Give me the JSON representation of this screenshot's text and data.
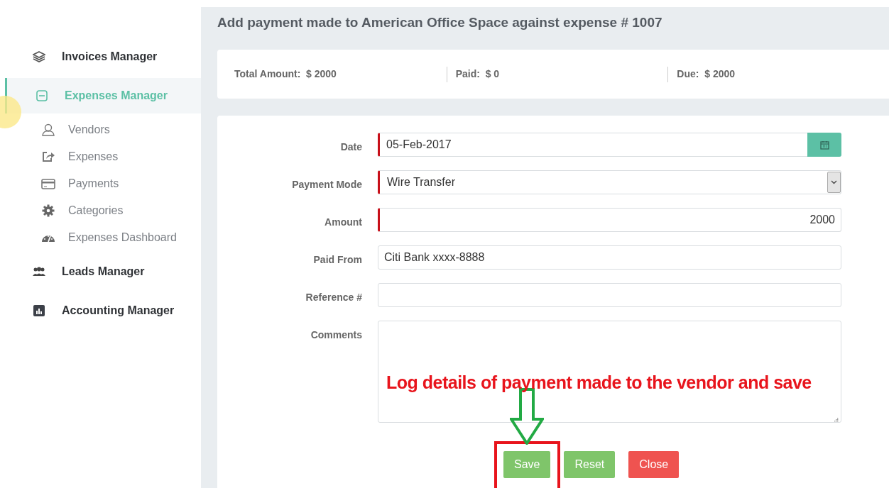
{
  "sidebar": {
    "items": [
      {
        "label": "Invoices Manager",
        "selected": false
      },
      {
        "label": "Expenses Manager",
        "selected": true,
        "expanded": true,
        "children": [
          {
            "label": "Vendors"
          },
          {
            "label": "Expenses"
          },
          {
            "label": "Payments"
          },
          {
            "label": "Categories"
          },
          {
            "label": "Expenses Dashboard"
          }
        ]
      },
      {
        "label": "Leads Manager",
        "selected": false
      },
      {
        "label": "Accounting Manager",
        "selected": false
      }
    ]
  },
  "page_title": "Add payment made to American Office Space against expense # 1007",
  "summary": [
    {
      "label": "Total Amount:",
      "value": "$ 2000"
    },
    {
      "label": "Paid:",
      "value": "$ 0"
    },
    {
      "label": "Due:",
      "value": "$ 2000"
    }
  ],
  "form": {
    "fields": [
      {
        "label": "Date",
        "kind": "date",
        "value": "05-Feb-2017",
        "required": true
      },
      {
        "label": "Payment Mode",
        "kind": "select",
        "value": "Wire Transfer",
        "required": true
      },
      {
        "label": "Amount",
        "kind": "number",
        "value": "2000",
        "required": true
      },
      {
        "label": "Paid From",
        "kind": "text",
        "value": "Citi Bank xxxx-8888",
        "required": false
      },
      {
        "label": "Reference #",
        "kind": "text",
        "required": false
      },
      {
        "label": "Comments",
        "kind": "textarea",
        "required": false
      }
    ],
    "buttons": [
      {
        "label": "Save",
        "kind": "success",
        "highlighted": true
      },
      {
        "label": "Reset",
        "kind": "success",
        "highlighted": false
      },
      {
        "label": "Close",
        "kind": "danger",
        "highlighted": false
      }
    ]
  },
  "annotation": "Log details of payment made to the vendor and save"
}
